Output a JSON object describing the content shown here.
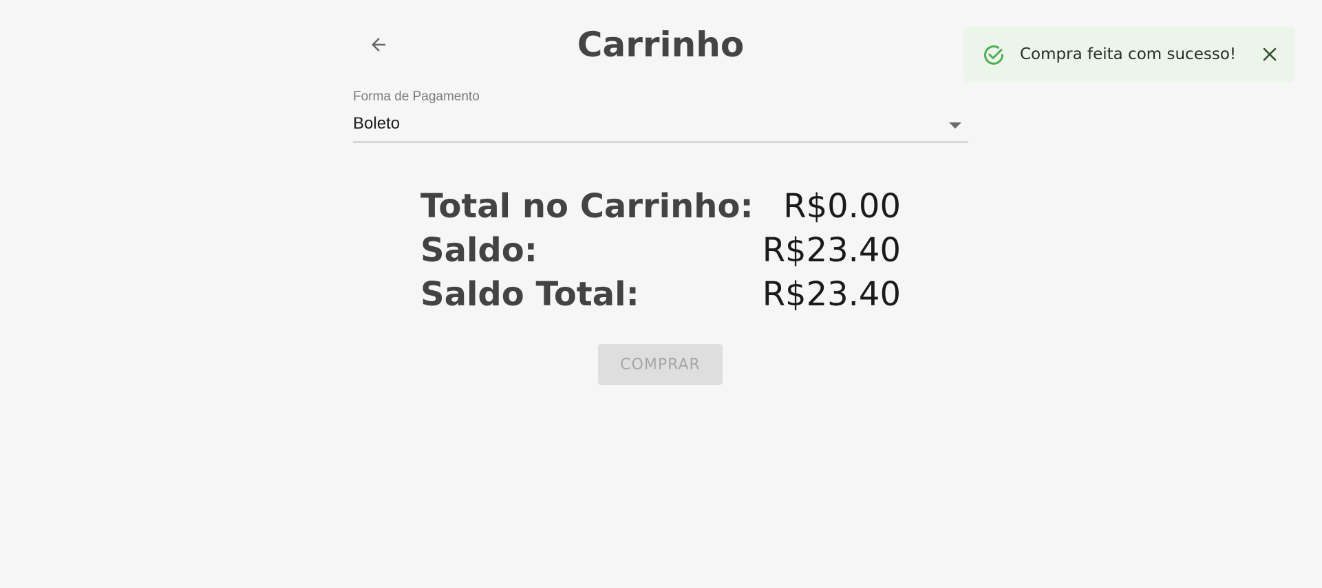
{
  "header": {
    "title": "Carrinho",
    "back_icon": "arrow-left-icon"
  },
  "payment": {
    "label": "Forma de Pagamento",
    "selected": "Boleto"
  },
  "summary": {
    "rows": [
      {
        "label": "Total no Carrinho:",
        "value": "R$0.00"
      },
      {
        "label": "Saldo:",
        "value": "R$23.40"
      },
      {
        "label": "Saldo Total:",
        "value": "R$23.40"
      }
    ]
  },
  "actions": {
    "buy_label": "COMPRAR",
    "buy_disabled": true
  },
  "toast": {
    "message": "Compra feita com sucesso!",
    "status": "success",
    "icon": "check-circle-icon",
    "close_icon": "close-icon",
    "accent_color": "#4caf50",
    "background_color": "#ecf5ea"
  }
}
